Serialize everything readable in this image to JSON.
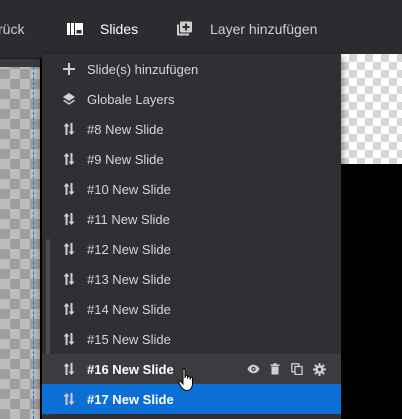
{
  "topbar": {
    "back_label": "rück",
    "slides_label": "Slides",
    "add_layer_label": "Layer hinzufügen"
  },
  "menu": {
    "items": [
      {
        "icon": "plus-icon",
        "label": "Slide(s) hinzufügen"
      },
      {
        "icon": "layers-icon",
        "label": "Globale Layers"
      },
      {
        "icon": "reorder-icon",
        "label": "#8 New Slide"
      },
      {
        "icon": "reorder-icon",
        "label": "#9 New Slide"
      },
      {
        "icon": "reorder-icon",
        "label": "#10 New Slide"
      },
      {
        "icon": "reorder-icon",
        "label": "#11 New Slide"
      },
      {
        "icon": "reorder-icon",
        "label": "#12 New Slide"
      },
      {
        "icon": "reorder-icon",
        "label": "#13 New Slide"
      },
      {
        "icon": "reorder-icon",
        "label": "#14 New Slide"
      },
      {
        "icon": "reorder-icon",
        "label": "#15 New Slide"
      },
      {
        "icon": "reorder-icon",
        "label": "#16 New Slide"
      },
      {
        "icon": "reorder-icon",
        "label": "#17 New Slide"
      }
    ],
    "hover_index": 10,
    "active_index": 11,
    "hover_actions": [
      "eye-icon",
      "trash-icon",
      "duplicate-icon",
      "gear-icon"
    ]
  },
  "colors": {
    "active": "#0b6fd6",
    "menu_bg": "#303034",
    "topbar_bg": "#2b2c30"
  }
}
